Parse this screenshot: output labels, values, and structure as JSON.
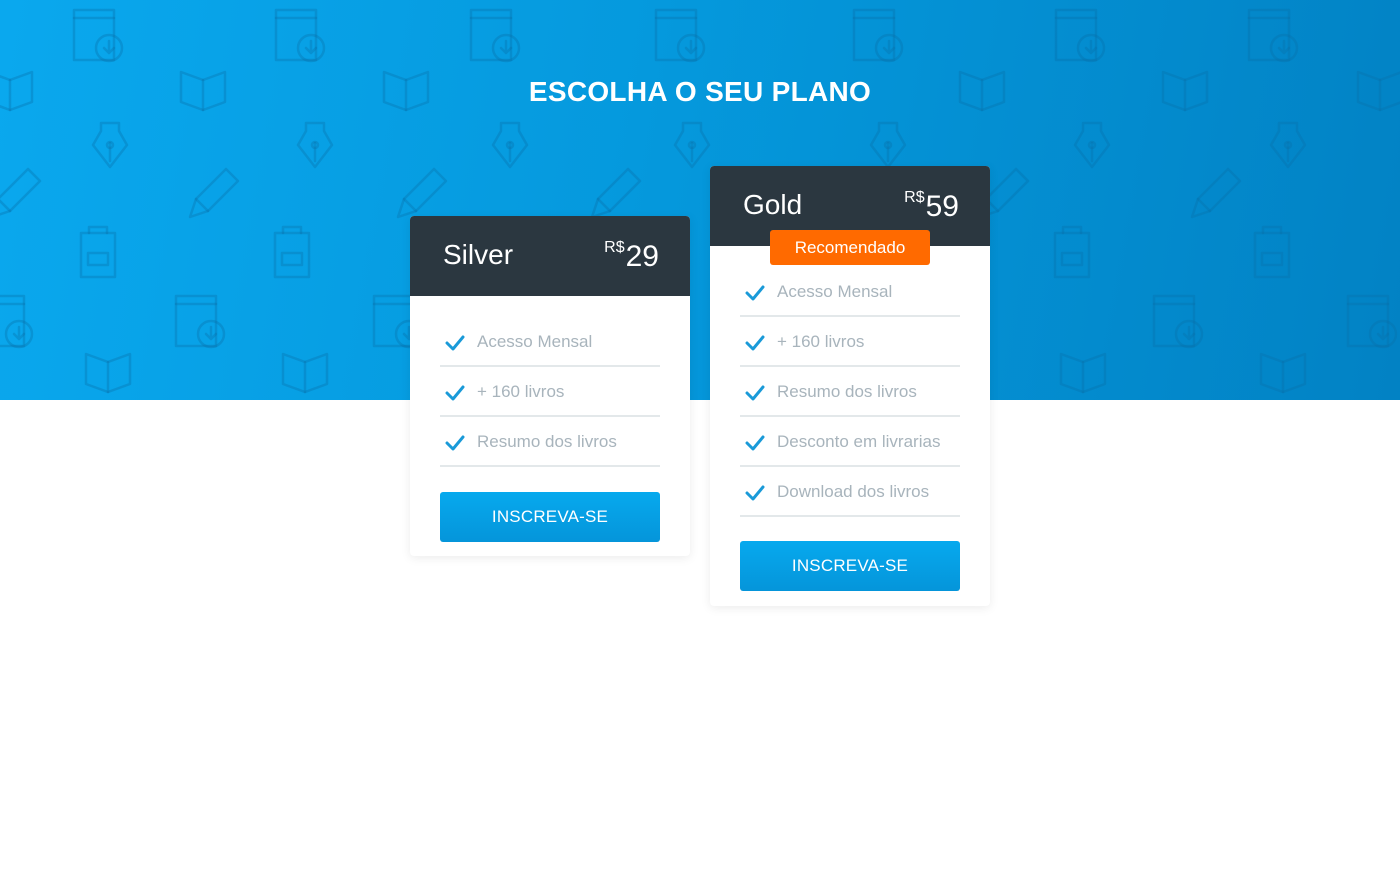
{
  "page": {
    "title": "ESCOLHA O SEU PLANO"
  },
  "plans": [
    {
      "name": "Silver",
      "currency": "R$",
      "price": "29",
      "features": [
        "Acesso Mensal",
        "+ 160 livros",
        "Resumo dos livros"
      ],
      "cta_label": "INSCREVA-SE"
    },
    {
      "name": "Gold",
      "currency": "R$",
      "price": "59",
      "badge": "Recomendado",
      "features": [
        "Acesso Mensal",
        "+ 160 livros",
        "Resumo dos livros",
        "Desconto em livrarias",
        "Download dos livros"
      ],
      "cta_label": "INSCREVA-SE"
    }
  ],
  "colors": {
    "hero_blue": "#0599dd",
    "card_header": "#2b3740",
    "badge_orange": "#ff6a00",
    "check_blue": "#1a9ad8",
    "feature_text": "#a8b4bc"
  },
  "icons": [
    "book-download-icon",
    "open-book-icon",
    "fountain-pen-icon",
    "pencil-icon",
    "backpack-icon",
    "check-icon"
  ]
}
